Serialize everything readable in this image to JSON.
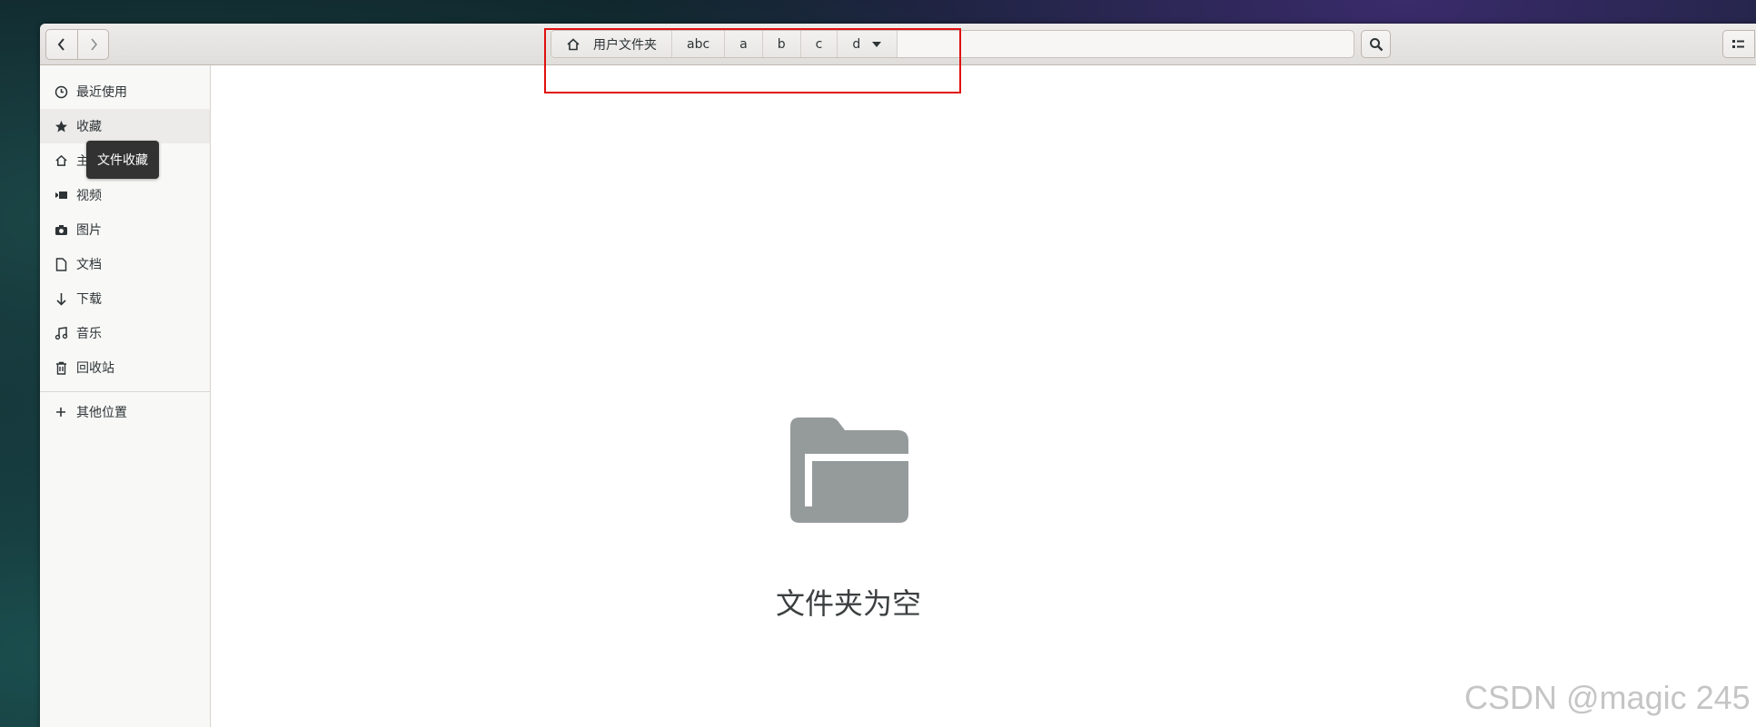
{
  "nav": {
    "back_glyph": "‹",
    "forward_glyph": "›"
  },
  "pathbar": {
    "home_label": "用户文件夹",
    "crumbs": [
      "abc",
      "a",
      "b",
      "c",
      "d"
    ],
    "home_icon": "home-icon",
    "dropdown_icon": "triangle-down-icon"
  },
  "toolbar": {
    "search_icon": "search-icon",
    "view_icon": "list-view-icon"
  },
  "sidebar": {
    "items": [
      {
        "label": "最近使用",
        "icon": "clock-icon"
      },
      {
        "label": "收藏",
        "icon": "star-icon"
      },
      {
        "label": "主目录",
        "icon": "home-icon"
      },
      {
        "label": "视频",
        "icon": "video-icon"
      },
      {
        "label": "图片",
        "icon": "camera-icon"
      },
      {
        "label": "文档",
        "icon": "document-icon"
      },
      {
        "label": "下载",
        "icon": "download-arrow-icon"
      },
      {
        "label": "音乐",
        "icon": "music-note-icon"
      },
      {
        "label": "回收站",
        "icon": "trash-icon"
      }
    ],
    "other_locations": {
      "label": "其他位置",
      "icon": "plus-icon"
    }
  },
  "tooltip": {
    "text": "文件收藏"
  },
  "main": {
    "empty_text": "文件夹为空",
    "empty_icon": "folder-icon",
    "folder_color": "#959a9b"
  },
  "watermark": {
    "text": "CSDN @magic 245"
  },
  "colors": {
    "highlight_box": "#e01010",
    "headerbar": "#e6e4e1",
    "sidebar_bg": "#f8f8f7"
  }
}
